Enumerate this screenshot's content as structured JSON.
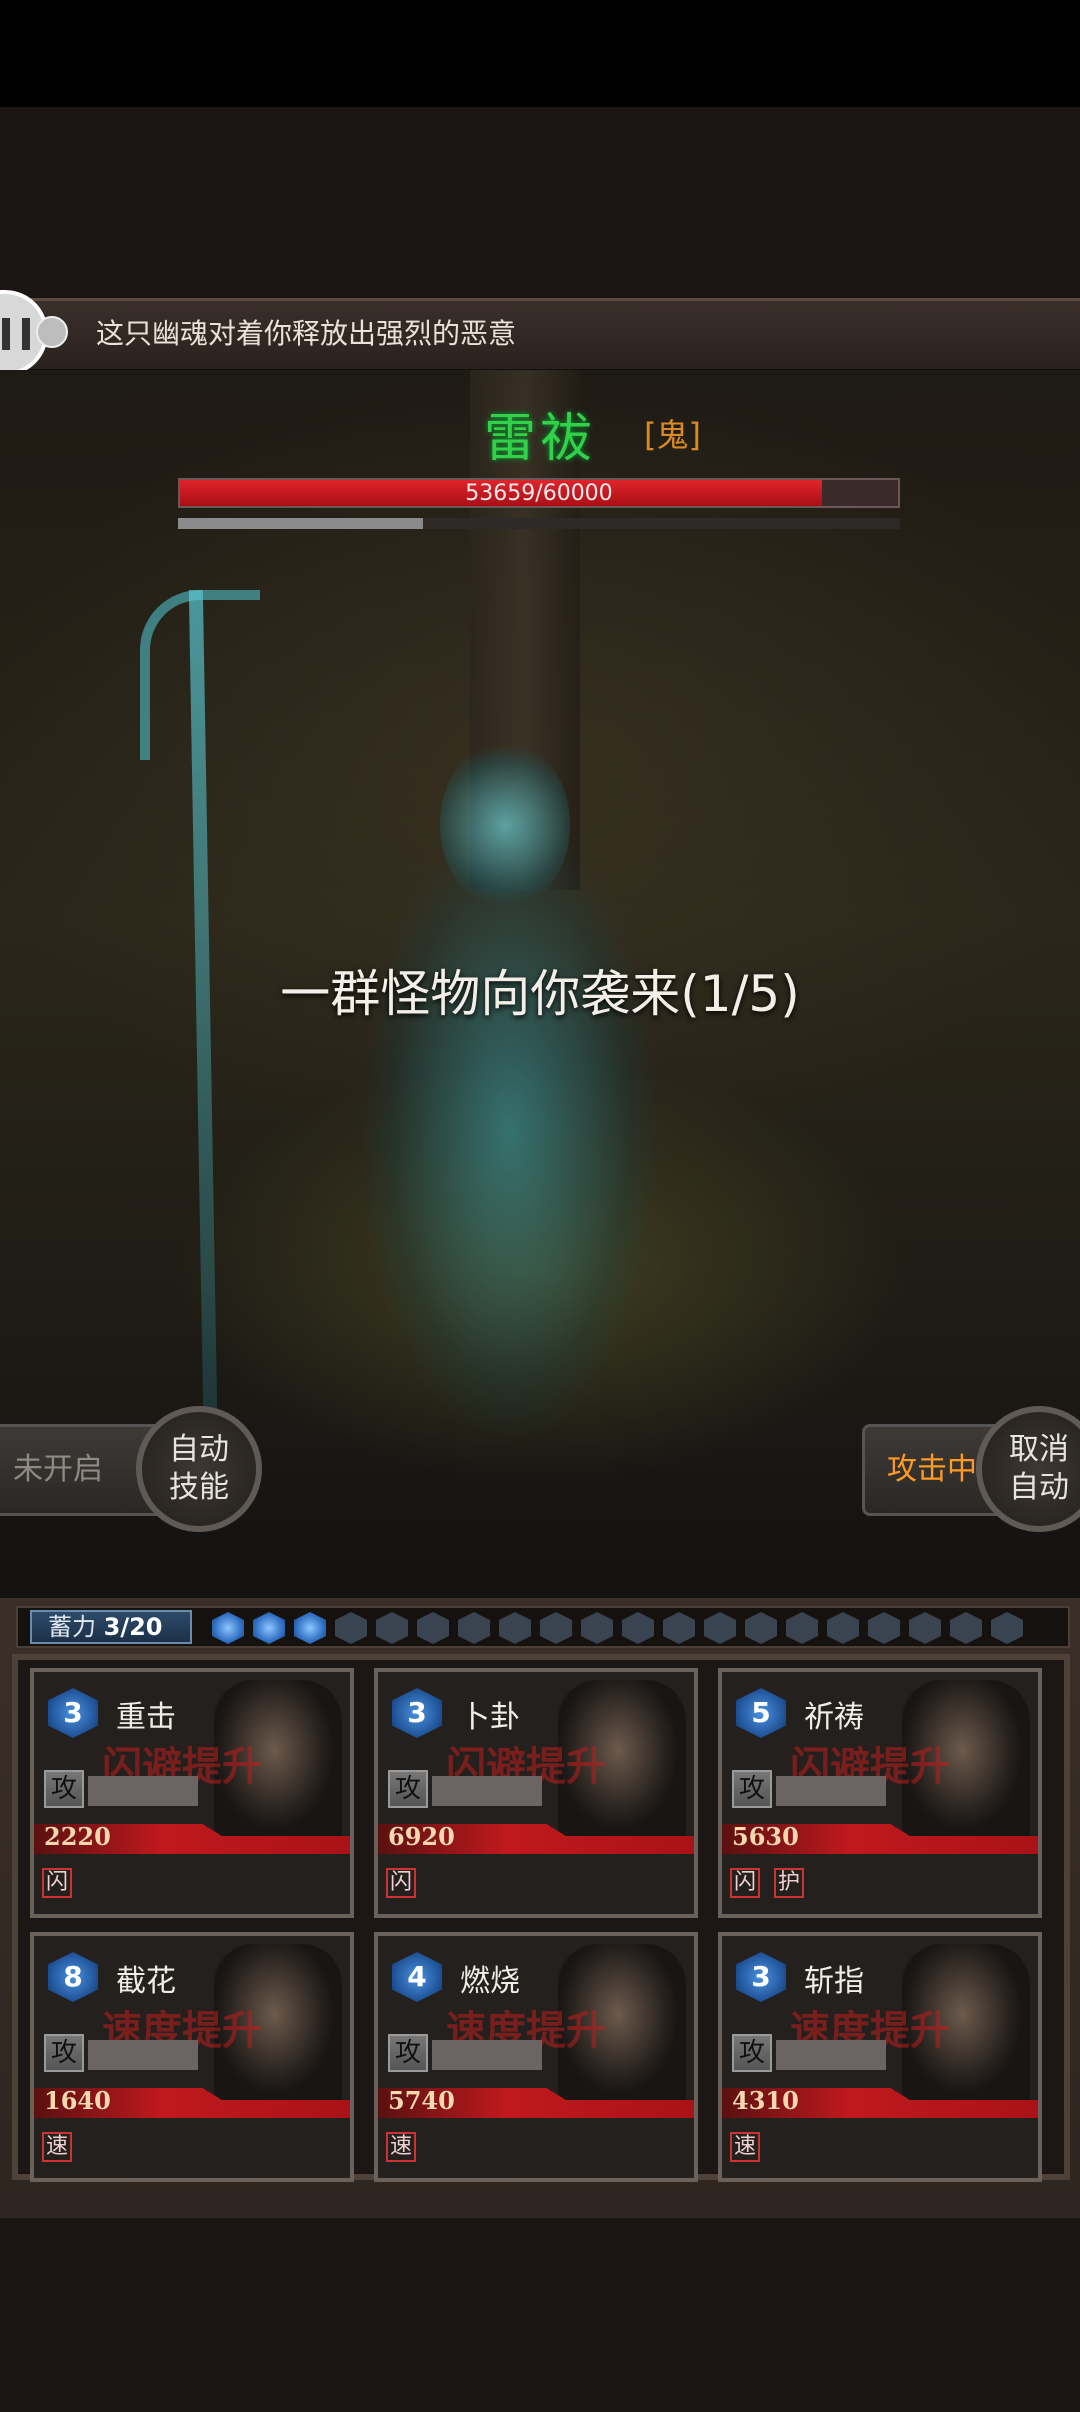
{
  "message": {
    "text": "这只幽魂对着你释放出强烈的恶意"
  },
  "monster": {
    "name": "雷祓",
    "tag": "[鬼]",
    "hp_text": "53659/60000",
    "hp_current": 53659,
    "hp_max": 60000,
    "secondary_fraction": 0.34
  },
  "battle": {
    "wave_text": "一群怪物向你袭来(1/5)"
  },
  "left_controls": {
    "status": "未开启",
    "auto_skill_line1": "自动",
    "auto_skill_line2": "技能"
  },
  "right_controls": {
    "status": "攻击中",
    "cancel_line1": "取消",
    "cancel_line2": "自动"
  },
  "charge": {
    "label": "蓄力",
    "value": "3/20",
    "current": 3,
    "max": 20
  },
  "cards": [
    {
      "level": "3",
      "skill": "重击",
      "ghost_text": "闪避提升",
      "attack_label": "攻",
      "hp": "2220",
      "tags": [
        "闪"
      ]
    },
    {
      "level": "3",
      "skill": "卜卦",
      "ghost_text": "闪避提升",
      "attack_label": "攻",
      "hp": "6920",
      "tags": [
        "闪"
      ]
    },
    {
      "level": "5",
      "skill": "祈祷",
      "ghost_text": "闪避提升",
      "attack_label": "攻",
      "hp": "5630",
      "tags": [
        "闪",
        "护"
      ]
    },
    {
      "level": "8",
      "skill": "截花",
      "ghost_text": "速度提升",
      "attack_label": "攻",
      "hp": "1640",
      "tags": [
        "速"
      ]
    },
    {
      "level": "4",
      "skill": "燃烧",
      "ghost_text": "速度提升",
      "attack_label": "攻",
      "hp": "5740",
      "tags": [
        "速"
      ]
    },
    {
      "level": "3",
      "skill": "斩指",
      "ghost_text": "速度提升",
      "attack_label": "攻",
      "hp": "4310",
      "tags": [
        "速"
      ]
    }
  ]
}
